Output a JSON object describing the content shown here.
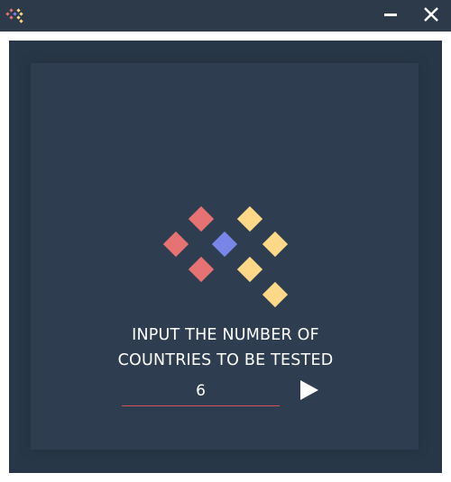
{
  "window": {
    "app_icon": "app-logo-icon",
    "minimize_icon": "minimize-icon",
    "close_icon": "close-icon"
  },
  "main": {
    "logo_icon": "diamond-logo-icon",
    "prompt_line1": "INPUT THE NUMBER OF",
    "prompt_line2": "COUNTRIES TO BE TESTED",
    "count_value": "6",
    "submit_icon": "play-icon"
  },
  "colors": {
    "titlebar": "#2d3a4a",
    "outer_panel": "#283748",
    "inner_panel": "#2e3d4f",
    "diamond_red": "#e57373",
    "diamond_blue": "#7986e8",
    "diamond_yellow": "#fdd888",
    "input_underline": "#d0525d"
  }
}
